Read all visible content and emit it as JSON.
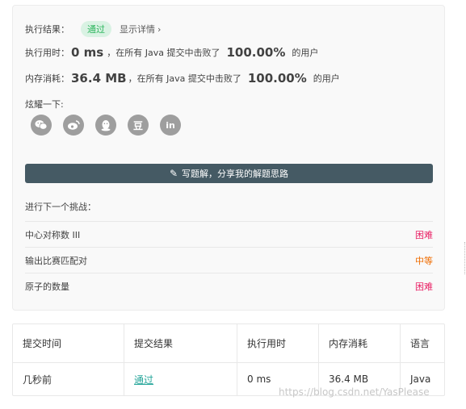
{
  "result": {
    "label": "执行结果：",
    "status": "通过",
    "detail_link": "显示详情"
  },
  "runtime": {
    "label": "执行用时：",
    "value": "0 ms",
    "mid": "，在所有 Java 提交中击败了",
    "percent": "100.00%",
    "suffix": "的用户"
  },
  "memory": {
    "label": "内存消耗：",
    "value": "36.4 MB",
    "mid": "，在所有 Java 提交中击败了",
    "percent": "100.00%",
    "suffix": "的用户"
  },
  "share": {
    "label": "炫耀一下:",
    "icons": [
      "wechat-icon",
      "weibo-icon",
      "qq-icon",
      "douban-icon",
      "linkedin-icon"
    ],
    "douban_glyph": "豆",
    "linkedin_glyph": "in"
  },
  "write_solution_label": "写题解，分享我的解题思路",
  "next_challenge": {
    "title": "进行下一个挑战：",
    "problems": [
      {
        "name": "中心对称数 III",
        "difficulty": "困难"
      },
      {
        "name": "输出比赛匹配对",
        "difficulty": "中等"
      },
      {
        "name": "原子的数量",
        "difficulty": "困难"
      }
    ]
  },
  "submissions": {
    "headers": [
      "提交时间",
      "提交结果",
      "执行用时",
      "内存消耗",
      "语言"
    ],
    "rows": [
      {
        "time": "几秒前",
        "result": "通过",
        "runtime": "0 ms",
        "memory": "36.4 MB",
        "language": "Java"
      }
    ]
  },
  "watermark": "https://blog.csdn.net/YasPlease",
  "colors": {
    "accent_green": "#2db55d",
    "button_dark": "#455a64",
    "hard": "#e91e63",
    "medium": "#ef6c00",
    "link_teal": "#26a69a"
  }
}
